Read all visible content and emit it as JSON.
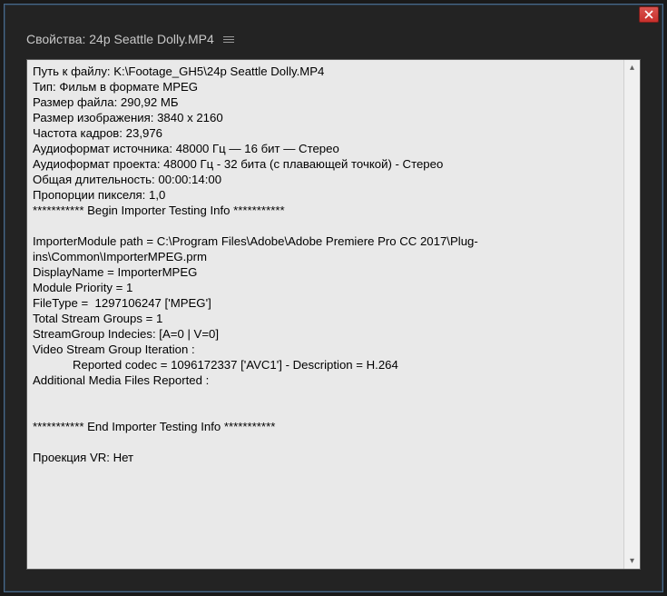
{
  "window": {
    "title": "Свойства: 24p Seattle Dolly.MP4"
  },
  "properties": {
    "file_path_label": "Путь к файлу:",
    "file_path": "K:\\Footage_GH5\\24p Seattle Dolly.MP4",
    "type_label": "Тип:",
    "type": "Фильм в формате MPEG",
    "file_size_label": "Размер файла:",
    "file_size": "290,92 МБ",
    "image_size_label": "Размер изображения:",
    "image_size": "3840 x 2160",
    "frame_rate_label": "Частота кадров:",
    "frame_rate": "23,976",
    "source_audio_label": "Аудиоформат источника:",
    "source_audio": "48000 Гц — 16 бит — Стерео",
    "project_audio_label": "Аудиоформат проекта:",
    "project_audio": "48000 Гц - 32 бита (с плавающей точкой) - Стерео",
    "duration_label": "Общая длительность:",
    "duration": "00:00:14:00",
    "pixel_aspect_label": "Пропорции пикселя:",
    "pixel_aspect": "1,0",
    "begin_marker": "*********** Begin Importer Testing Info ***********",
    "importer_module_path_label": "ImporterModule path =",
    "importer_module_path": "C:\\Program Files\\Adobe\\Adobe Premiere Pro CC 2017\\Plug-ins\\Common\\ImporterMPEG.prm",
    "display_name_label": "DisplayName =",
    "display_name": "ImporterMPEG",
    "module_priority_label": "Module Priority =",
    "module_priority": "1",
    "file_type_label": "FileType = ",
    "file_type": "1297106247 ['MPEG']",
    "total_stream_groups_label": "Total Stream Groups =",
    "total_stream_groups": "1",
    "stream_group_indices_label": "StreamGroup Indecies:",
    "stream_group_indices": "[A=0 | V=0]",
    "video_stream_iteration_label": "Video Stream Group Iteration :",
    "reported_codec_line": "            Reported codec = 1096172337 ['AVC1'] - Description = H.264",
    "additional_media_label": "Additional Media Files Reported :",
    "end_marker": "*********** End Importer Testing Info ***********",
    "vr_projection_label": "Проекция VR:",
    "vr_projection": "Нет"
  }
}
